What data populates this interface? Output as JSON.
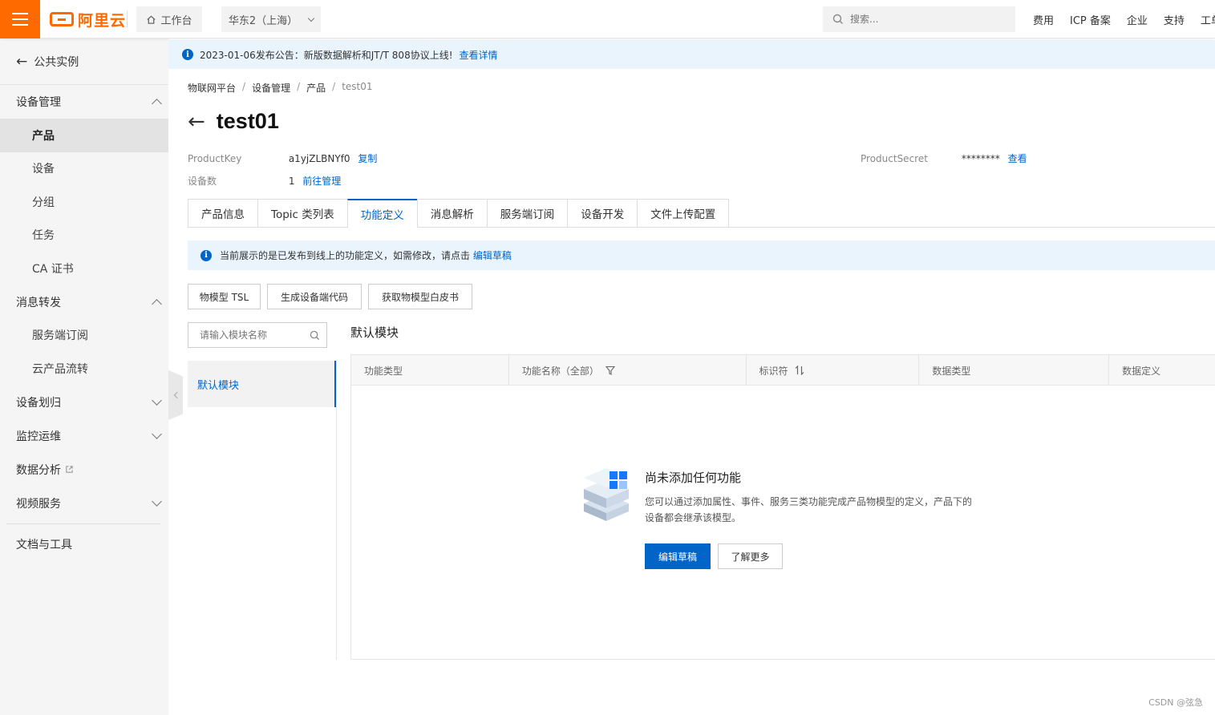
{
  "topbar": {
    "logo_text": "阿里云",
    "workbench_label": "工作台",
    "region_label": "华东2（上海）",
    "search_placeholder": "搜索...",
    "links": [
      "费用",
      "ICP 备案",
      "企业",
      "支持",
      "工单"
    ]
  },
  "sidebar": {
    "back_label": "公共实例",
    "groups": {
      "device_mgmt": "设备管理",
      "msg_forward": "消息转发",
      "device_assign": "设备划归",
      "monitor_ops": "监控运维",
      "data_analysis": "数据分析",
      "video_service": "视频服务",
      "docs_tools": "文档与工具"
    },
    "device_items": [
      "产品",
      "设备",
      "分组",
      "任务",
      "CA 证书"
    ],
    "msg_items": [
      "服务端订阅",
      "云产品流转"
    ]
  },
  "announcement": {
    "text": "2023-01-06发布公告：新版数据解析和JT/T 808协议上线!",
    "link": "查看详情"
  },
  "breadcrumb": [
    "物联网平台",
    "设备管理",
    "产品",
    "test01"
  ],
  "page_title": "test01",
  "meta": {
    "product_key_label": "ProductKey",
    "product_key_value": "a1yjZLBNYf0",
    "copy_link": "复制",
    "product_secret_label": "ProductSecret",
    "product_secret_value": "********",
    "view_link": "查看",
    "device_count_label": "设备数",
    "device_count_value": "1",
    "manage_link": "前往管理"
  },
  "tabs": [
    "产品信息",
    "Topic 类列表",
    "功能定义",
    "消息解析",
    "服务端订阅",
    "设备开发",
    "文件上传配置"
  ],
  "active_tab": "功能定义",
  "notice": {
    "text": "当前展示的是已发布到线上的功能定义，如需修改，请点击",
    "link": "编辑草稿"
  },
  "actions": {
    "tsl": "物模型 TSL",
    "gen_code": "生成设备端代码",
    "whitepaper": "获取物模型白皮书"
  },
  "module": {
    "search_placeholder": "请输入模块名称",
    "items": [
      "默认模块"
    ],
    "heading": "默认模块"
  },
  "table": {
    "columns": [
      "功能类型",
      "功能名称（全部）",
      "标识符",
      "数据类型",
      "数据定义"
    ]
  },
  "empty_state": {
    "title": "尚未添加任何功能",
    "description": "您可以通过添加属性、事件、服务三类功能完成产品物模型的定义，产品下的设备都会继承该模型。",
    "primary_button": "编辑草稿",
    "secondary_button": "了解更多"
  },
  "watermark": "CSDN @弦急",
  "colors": {
    "brand": "#ff6a00",
    "primary": "#0064c8",
    "info_bg": "#e9f4fd"
  }
}
